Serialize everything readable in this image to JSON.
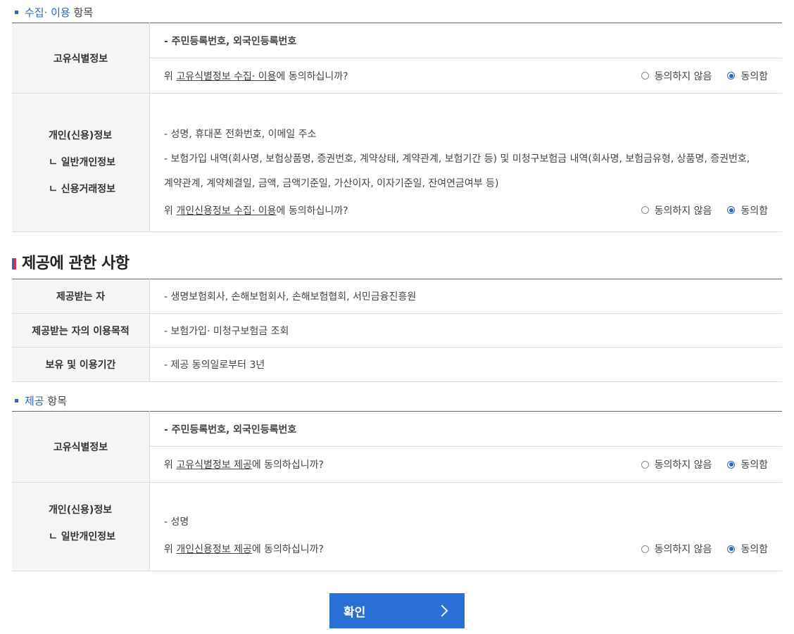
{
  "collect_items_heading": {
    "blue": "수집· 이용",
    "rest": "항목"
  },
  "collect": {
    "unique_id": {
      "label": "고유식별정보",
      "content": "- 주민등록번호, 외국인등록번호",
      "question_prefix": "위 ",
      "question_link": "고유식별정보 수집· 이용",
      "question_suffix": "에 동의하십니까?",
      "disagree": "동의하지 않음",
      "agree": "동의함",
      "selected": "agree"
    },
    "personal": {
      "label_main": "개인(신용)정보",
      "label_sub1": "ㄴ 일반개인정보",
      "label_sub2": "ㄴ 신용거래정보",
      "general": "- 성명, 휴대폰 전화번호, 이메일 주소",
      "credit_line1": "- 보험가입 내역(회사명, 보험상품명, 증권번호, 계약상태, 계약관계, 보험기간 등) 및 미청구보험금 내역(회사명, 보험금유형, 상품명, 증권번호,",
      "credit_line2": "계약관계, 계약체결일, 금액, 금액기준일, 가산이자, 이자기준일, 잔여연금여부 등)",
      "question_prefix": "위 ",
      "question_link": "개인신용정보 수집· 이용",
      "question_suffix": "에 동의하십니까?",
      "disagree": "동의하지 않음",
      "agree": "동의함",
      "selected": "agree"
    }
  },
  "provide_section_title": "제공에 관한 사항",
  "provide_info": [
    {
      "label": "제공받는 자",
      "value": "- 생명보험회사, 손해보험회사, 손해보험협회, 서민금융진흥원"
    },
    {
      "label": "제공받는 자의 이용목적",
      "value": "- 보험가입· 미청구보험금 조회"
    },
    {
      "label": "보유 및 이용기간",
      "value": "- 제공 동의일로부터 3년"
    }
  ],
  "provide_items_heading": {
    "blue": "제공",
    "rest": "항목"
  },
  "provide": {
    "unique_id": {
      "label": "고유식별정보",
      "content": "- 주민등록번호, 외국인등록번호",
      "question_prefix": "위 ",
      "question_link": "고유식별정보 제공",
      "question_suffix": "에 동의하십니까?",
      "disagree": "동의하지 않음",
      "agree": "동의함",
      "selected": "agree"
    },
    "personal": {
      "label_main": "개인(신용)정보",
      "label_sub1": "ㄴ 일반개인정보",
      "general": "- 성명",
      "question_prefix": "위 ",
      "question_link": "개인신용정보 제공",
      "question_suffix": "에 동의하십니까?",
      "disagree": "동의하지 않음",
      "agree": "동의함",
      "selected": "agree"
    }
  },
  "confirm_label": "확인",
  "colors": {
    "accent": "#2a6fd6",
    "heading_blue": "#2a66c8",
    "flag_red": "#d8334a"
  }
}
